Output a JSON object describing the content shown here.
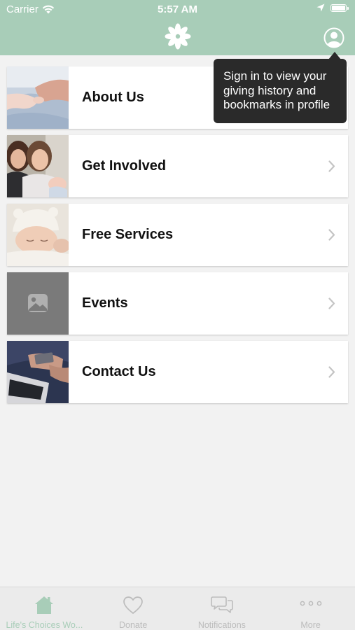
{
  "status_bar": {
    "carrier": "Carrier",
    "time": "5:57 AM"
  },
  "header": {
    "logo_icon": "flower-icon",
    "profile_icon": "user-icon",
    "background": "#a8cdb8"
  },
  "tooltip": {
    "text": "Sign in to view your giving history and bookmarks in profile"
  },
  "menu": {
    "items": [
      {
        "label": "About Us",
        "icon": "baby-hand-photo"
      },
      {
        "label": "Get Involved",
        "icon": "women-with-baby-photo"
      },
      {
        "label": "Free Services",
        "icon": "sleeping-baby-photo"
      },
      {
        "label": "Events",
        "icon": "image-placeholder-icon"
      },
      {
        "label": "Contact Us",
        "icon": "phone-laptop-photo"
      }
    ]
  },
  "tabbar": {
    "tabs": [
      {
        "label": "Life's Choices Wo...",
        "icon": "home-icon",
        "active": true
      },
      {
        "label": "Donate",
        "icon": "heart-icon",
        "active": false
      },
      {
        "label": "Notifications",
        "icon": "chat-bubbles-icon",
        "active": false
      },
      {
        "label": "More",
        "icon": "more-dots-icon",
        "active": false
      }
    ]
  },
  "colors": {
    "accent": "#a8cdb8",
    "tooltip_bg": "#2a2a2a",
    "tab_inactive": "#bcbcbc"
  }
}
